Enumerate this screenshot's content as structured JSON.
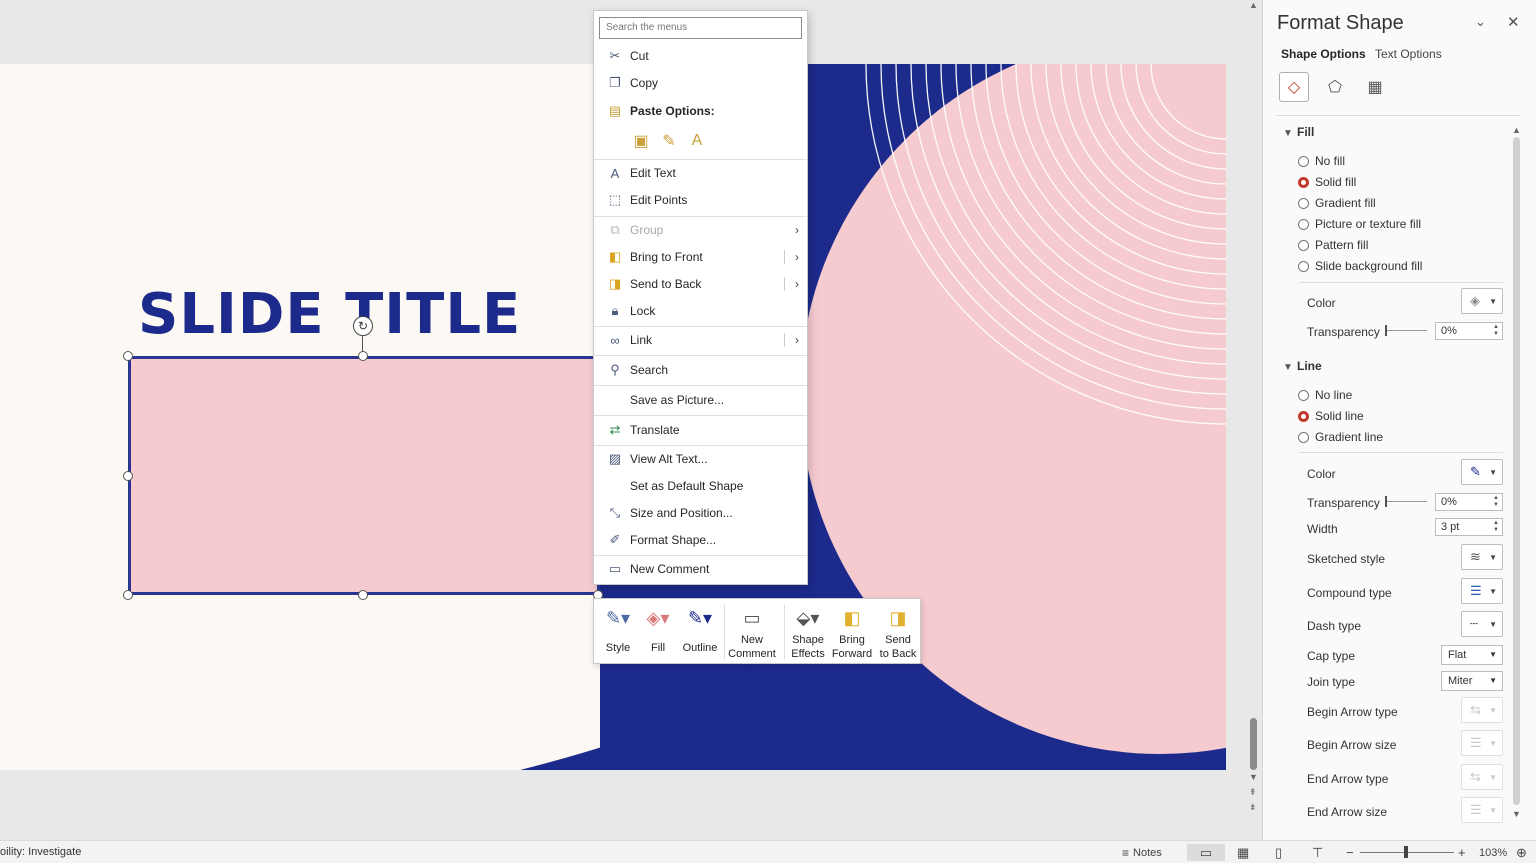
{
  "slide": {
    "title": "SLIDE TITLE",
    "colors": {
      "navy": "#1c2a8c",
      "pink": "#f5cbd0",
      "cream": "#fcf9f4"
    }
  },
  "context_menu": {
    "search_placeholder": "Search the menus",
    "items": [
      {
        "label": "Cut",
        "icon": "scissors-icon"
      },
      {
        "label": "Copy",
        "icon": "copy-icon"
      },
      {
        "label": "Paste Options:",
        "icon": "paste-icon"
      },
      {
        "label": "Edit Text",
        "icon": "edit-text-icon"
      },
      {
        "label": "Edit Points",
        "icon": "edit-points-icon"
      },
      {
        "label": "Group",
        "icon": "group-icon",
        "disabled": true
      },
      {
        "label": "Bring to Front",
        "icon": "bring-to-front-icon"
      },
      {
        "label": "Send to Back",
        "icon": "send-to-back-icon"
      },
      {
        "label": "Lock",
        "icon": "lock-icon"
      },
      {
        "label": "Link",
        "icon": "link-icon"
      },
      {
        "label": "Search",
        "icon": "search-icon"
      },
      {
        "label": "Save as Picture...",
        "icon": ""
      },
      {
        "label": "Translate",
        "icon": "translate-icon"
      },
      {
        "label": "View Alt Text...",
        "icon": "alt-text-icon"
      },
      {
        "label": "Set as Default Shape",
        "icon": ""
      },
      {
        "label": "Size and Position...",
        "icon": "size-position-icon"
      },
      {
        "label": "Format Shape...",
        "icon": "format-shape-icon"
      },
      {
        "label": "New Comment",
        "icon": "comment-icon"
      }
    ]
  },
  "mini_toolbar": {
    "buttons": [
      {
        "label": "Style",
        "icon": "style-icon"
      },
      {
        "label": "Fill",
        "icon": "fill-bucket-icon"
      },
      {
        "label": "Outline",
        "icon": "outline-pen-icon"
      },
      {
        "label": "New Comment",
        "line1": "New",
        "line2": "Comment",
        "icon": "comment-icon"
      },
      {
        "label": "Shape Effects",
        "line1": "Shape",
        "line2": "Effects",
        "icon": "shape-effects-icon"
      },
      {
        "label": "Bring Forward",
        "line1": "Bring",
        "line2": "Forward",
        "icon": "bring-forward-icon"
      },
      {
        "label": "Send to Back",
        "line1": "Send",
        "line2": "to Back",
        "icon": "send-to-back-icon"
      }
    ]
  },
  "format_pane": {
    "title": "Format Shape",
    "tabs": {
      "shape": "Shape Options",
      "text": "Text Options"
    },
    "fill": {
      "heading": "Fill",
      "options": [
        "No fill",
        "Solid fill",
        "Gradient fill",
        "Picture or texture fill",
        "Pattern fill",
        "Slide background fill"
      ],
      "selected": "Solid fill",
      "color_label": "Color",
      "transparency_label": "Transparency",
      "transparency_value": "0%"
    },
    "line": {
      "heading": "Line",
      "options": [
        "No line",
        "Solid line",
        "Gradient line"
      ],
      "selected": "Solid line",
      "color_label": "Color",
      "transparency_label": "Transparency",
      "transparency_value": "0%",
      "width_label": "Width",
      "width_value": "3 pt",
      "sketched_label": "Sketched style",
      "compound_label": "Compound type",
      "dash_label": "Dash type",
      "cap_label": "Cap type",
      "cap_value": "Flat",
      "join_label": "Join type",
      "join_value": "Miter",
      "begin_arrow_type_label": "Begin Arrow type",
      "begin_arrow_size_label": "Begin Arrow size",
      "end_arrow_type_label": "End Arrow type",
      "end_arrow_size_label": "End Arrow size"
    }
  },
  "status_bar": {
    "accessibility": "oility: Investigate",
    "notes": "Notes",
    "zoom": "103%"
  }
}
